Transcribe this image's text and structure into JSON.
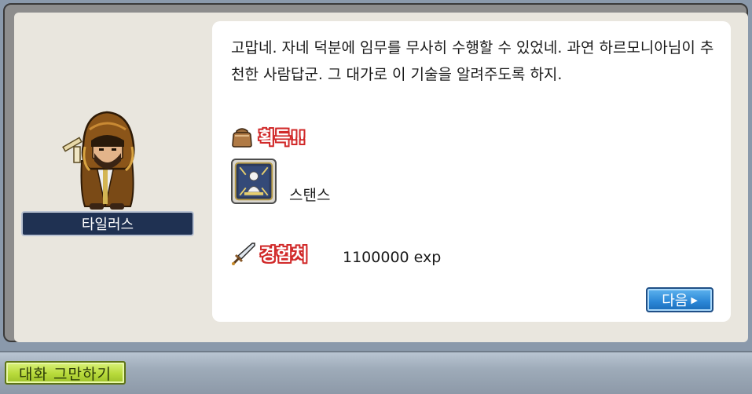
{
  "dialog": {
    "message": "고맙네. 자네 덕분에 임무를 무사히 수행할 수 있었네. 과연 하르모니아님이 추천한 사람답군. 그 대가로 이 기술을 알려주도록 하지.",
    "npc_name": "타일러스",
    "reward_heading": "획득!!",
    "skill_name": "스탠스",
    "exp_heading": "경험치",
    "exp_value": "1100000 exp",
    "next_label": "다음",
    "next_arrow": "▶"
  },
  "bottom_bar": {
    "end_chat_label": "대화 그만하기"
  },
  "colors": {
    "heading_outline": "#d12a2a",
    "next_button": "#2a86d6",
    "end_chat_button": "#b8da3a",
    "name_plate": "#1f3152"
  },
  "icons": {
    "reward": "bag-icon",
    "skill": "stance-skill-icon",
    "exp": "sword-icon"
  }
}
